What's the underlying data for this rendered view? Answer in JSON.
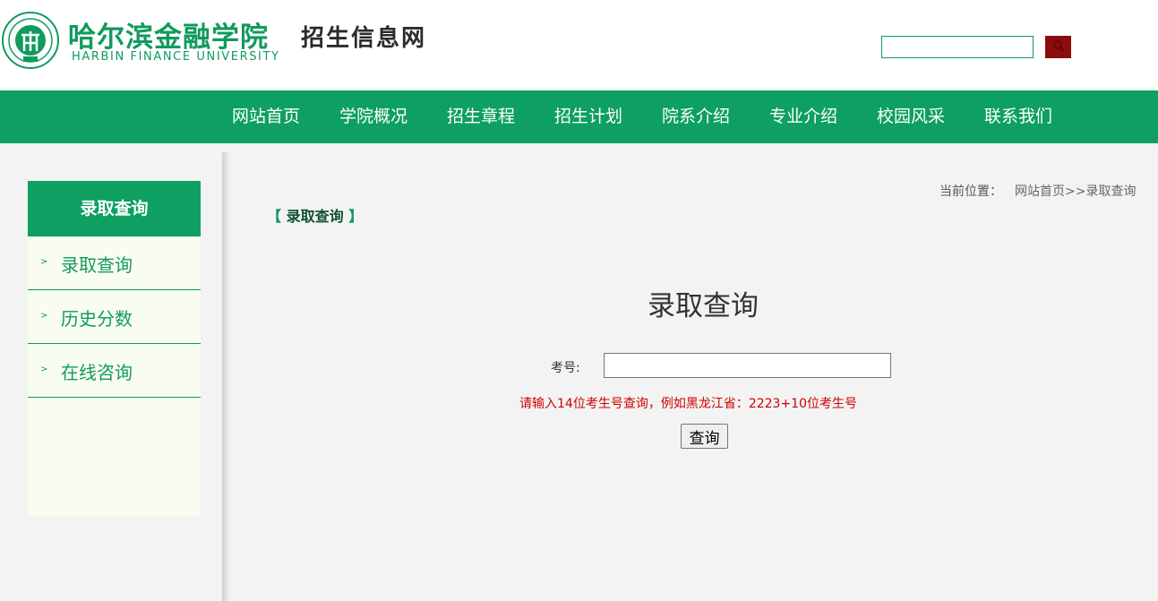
{
  "header": {
    "logo_cn": "哈尔滨金融学院",
    "logo_en": "HARBIN FINANCE UNIVERSITY",
    "site_subtitle": "招生信息网",
    "search_value": "",
    "search_icon": "magnifier-icon",
    "colors": {
      "brand_green": "#119a5e",
      "search_button": "#8b0d0d"
    }
  },
  "nav": {
    "items": [
      "网站首页",
      "学院概况",
      "招生章程",
      "招生计划",
      "院系介绍",
      "专业介绍",
      "校园风采",
      "联系我们"
    ]
  },
  "sidebar": {
    "title": "录取查询",
    "items": [
      {
        "label": "录取查询",
        "icon": "chevron-right-icon"
      },
      {
        "label": "历史分数",
        "icon": "chevron-right-icon"
      },
      {
        "label": "在线咨询",
        "icon": "chevron-right-icon"
      }
    ]
  },
  "breadcrumb": {
    "prefix": "当前位置：",
    "path": "网站首页>>录取查询"
  },
  "section": {
    "bracket_open": "【",
    "title": "录取查询",
    "bracket_close": "】"
  },
  "form": {
    "heading": "录取查询",
    "exam_label": "考号:",
    "exam_value": "",
    "hint": "请输入14位考生号查询，例如黑龙江省：2223+10位考生号",
    "submit_label": "查询",
    "colors": {
      "hint": "#d00000"
    }
  }
}
